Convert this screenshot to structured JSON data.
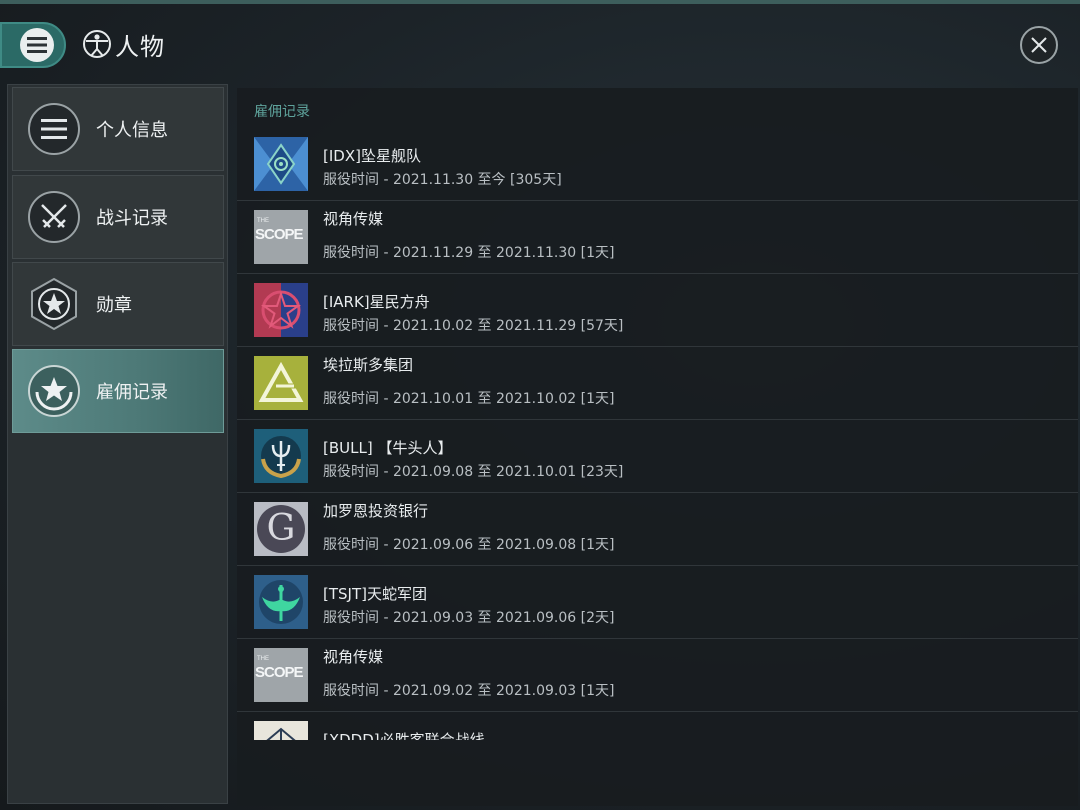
{
  "header": {
    "title": "人物",
    "menu_icon": "hamburger-icon",
    "title_icon": "vitruvian-man-icon",
    "close_icon": "close-icon"
  },
  "sidebar": {
    "items": [
      {
        "label": "个人信息",
        "icon": "list-icon"
      },
      {
        "label": "战斗记录",
        "icon": "crossed-swords-icon"
      },
      {
        "label": "勋章",
        "icon": "star-hexagon-icon"
      },
      {
        "label": "雇佣记录",
        "icon": "star-wreath-icon",
        "active": true
      }
    ]
  },
  "main": {
    "section_title": "雇佣记录",
    "records": [
      {
        "name": "[IDX]坠星舰队",
        "service": "服役时间 - 2021.11.30 至今 [305天]",
        "logo": "idx-logo"
      },
      {
        "name": "视角传媒",
        "service": "服役时间 - 2021.11.29 至 2021.11.30 [1天]",
        "logo": "scope-logo",
        "logo_text": "SCOPE",
        "logo_small": "THE"
      },
      {
        "name": "[IARK]星民方舟",
        "service": "服役时间 - 2021.10.02 至 2021.11.29 [57天]",
        "logo": "iark-logo"
      },
      {
        "name": "埃拉斯多集团",
        "service": "服役时间 - 2021.10.01 至 2021.10.02 [1天]",
        "logo": "arasaka-logo"
      },
      {
        "name": "[BULL] 【牛头人】",
        "service": "服役时间 - 2021.09.08 至 2021.10.01 [23天]",
        "logo": "bull-trident-logo"
      },
      {
        "name": "加罗恩投资银行",
        "service": "服役时间 - 2021.09.06 至 2021.09.08 [1天]",
        "logo": "g-logo",
        "logo_text": "G"
      },
      {
        "name": "[TSJT]天蛇军团",
        "service": "服役时间 - 2021.09.03 至 2021.09.06 [2天]",
        "logo": "serpent-logo"
      },
      {
        "name": "视角传媒",
        "service": "服役时间 - 2021.09.02 至 2021.09.03 [1天]",
        "logo": "scope-logo",
        "logo_text": "SCOPE",
        "logo_small": "THE"
      },
      {
        "name": "[XDDD]必胜客联合战线",
        "service": "",
        "logo": "xddd-logo"
      }
    ]
  },
  "colors": {
    "accent": "#5ea29b",
    "active_nav": "#5d8b89",
    "menu_button": "#2b6a66"
  }
}
